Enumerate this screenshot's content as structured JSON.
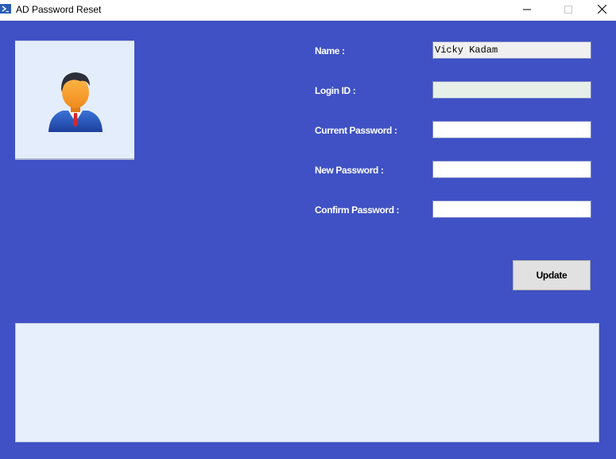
{
  "window": {
    "title": "AD Password Reset",
    "app_icon": "powershell-icon"
  },
  "form": {
    "name_label": "Name :",
    "name_value": "Vicky Kadam",
    "login_label": "Login ID :",
    "login_value": "",
    "current_password_label": "Current Password :",
    "current_password_value": "",
    "new_password_label": "New Password :",
    "new_password_value": "",
    "confirm_password_label": "Confirm Password :",
    "confirm_password_value": "",
    "update_label": "Update"
  },
  "output": {
    "text": ""
  },
  "colors": {
    "background": "#3f51c4",
    "titlebar": "#ffffff",
    "avatar_panel": "#e4edfb",
    "output_panel": "#e7effc"
  },
  "icons": {
    "avatar": "user-avatar-icon",
    "minimize": "minimize-icon",
    "maximize": "maximize-icon",
    "close": "close-icon"
  }
}
